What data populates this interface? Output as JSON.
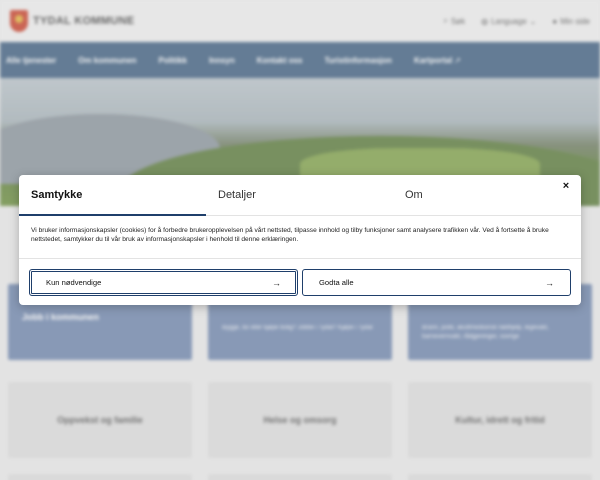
{
  "header": {
    "logo_text": "TYDAL KOMMUNE",
    "search": "Søk",
    "language": "Language",
    "my_page": "Min side"
  },
  "nav": {
    "items": [
      "Alle tjenester",
      "Om kommunen",
      "Politikk",
      "Innsyn",
      "Kontakt oss",
      "Turistinformasjon",
      "Kartportal"
    ]
  },
  "tiles": {
    "jobb": "Jobb i kommunen",
    "tile2_text": "Bygge, bo eller kjøpe bolig? Jobbe i Tydal? Kjøpe i Tydal",
    "tile3_text": "Brann, politi, akuttmedisinsk nødhjelp, legevakt, barnevernvakt, rådgjeninger, sovrige",
    "oppvekst": "Oppvekst og familie",
    "helse": "Helse og omsorg",
    "kultur": "Kultur, idrett og fritid"
  },
  "cookie": {
    "tabs": [
      "Samtykke",
      "Detaljer",
      "Om"
    ],
    "close": "×",
    "message": "Vi bruker informasjonskapsler (cookies) for å forbedre brukeropplevelsen på vårt nettsted, tilpasse innhold og tilby funksjoner samt analysere trafikken vår. Ved å fortsette å bruke nettstedet, samtykker du til vår bruk av informasjonskapsler i henhold til denne erklæringen.",
    "btn_necessary": "Kun nødvendige",
    "btn_accept": "Godta alle",
    "arrow": "→"
  }
}
